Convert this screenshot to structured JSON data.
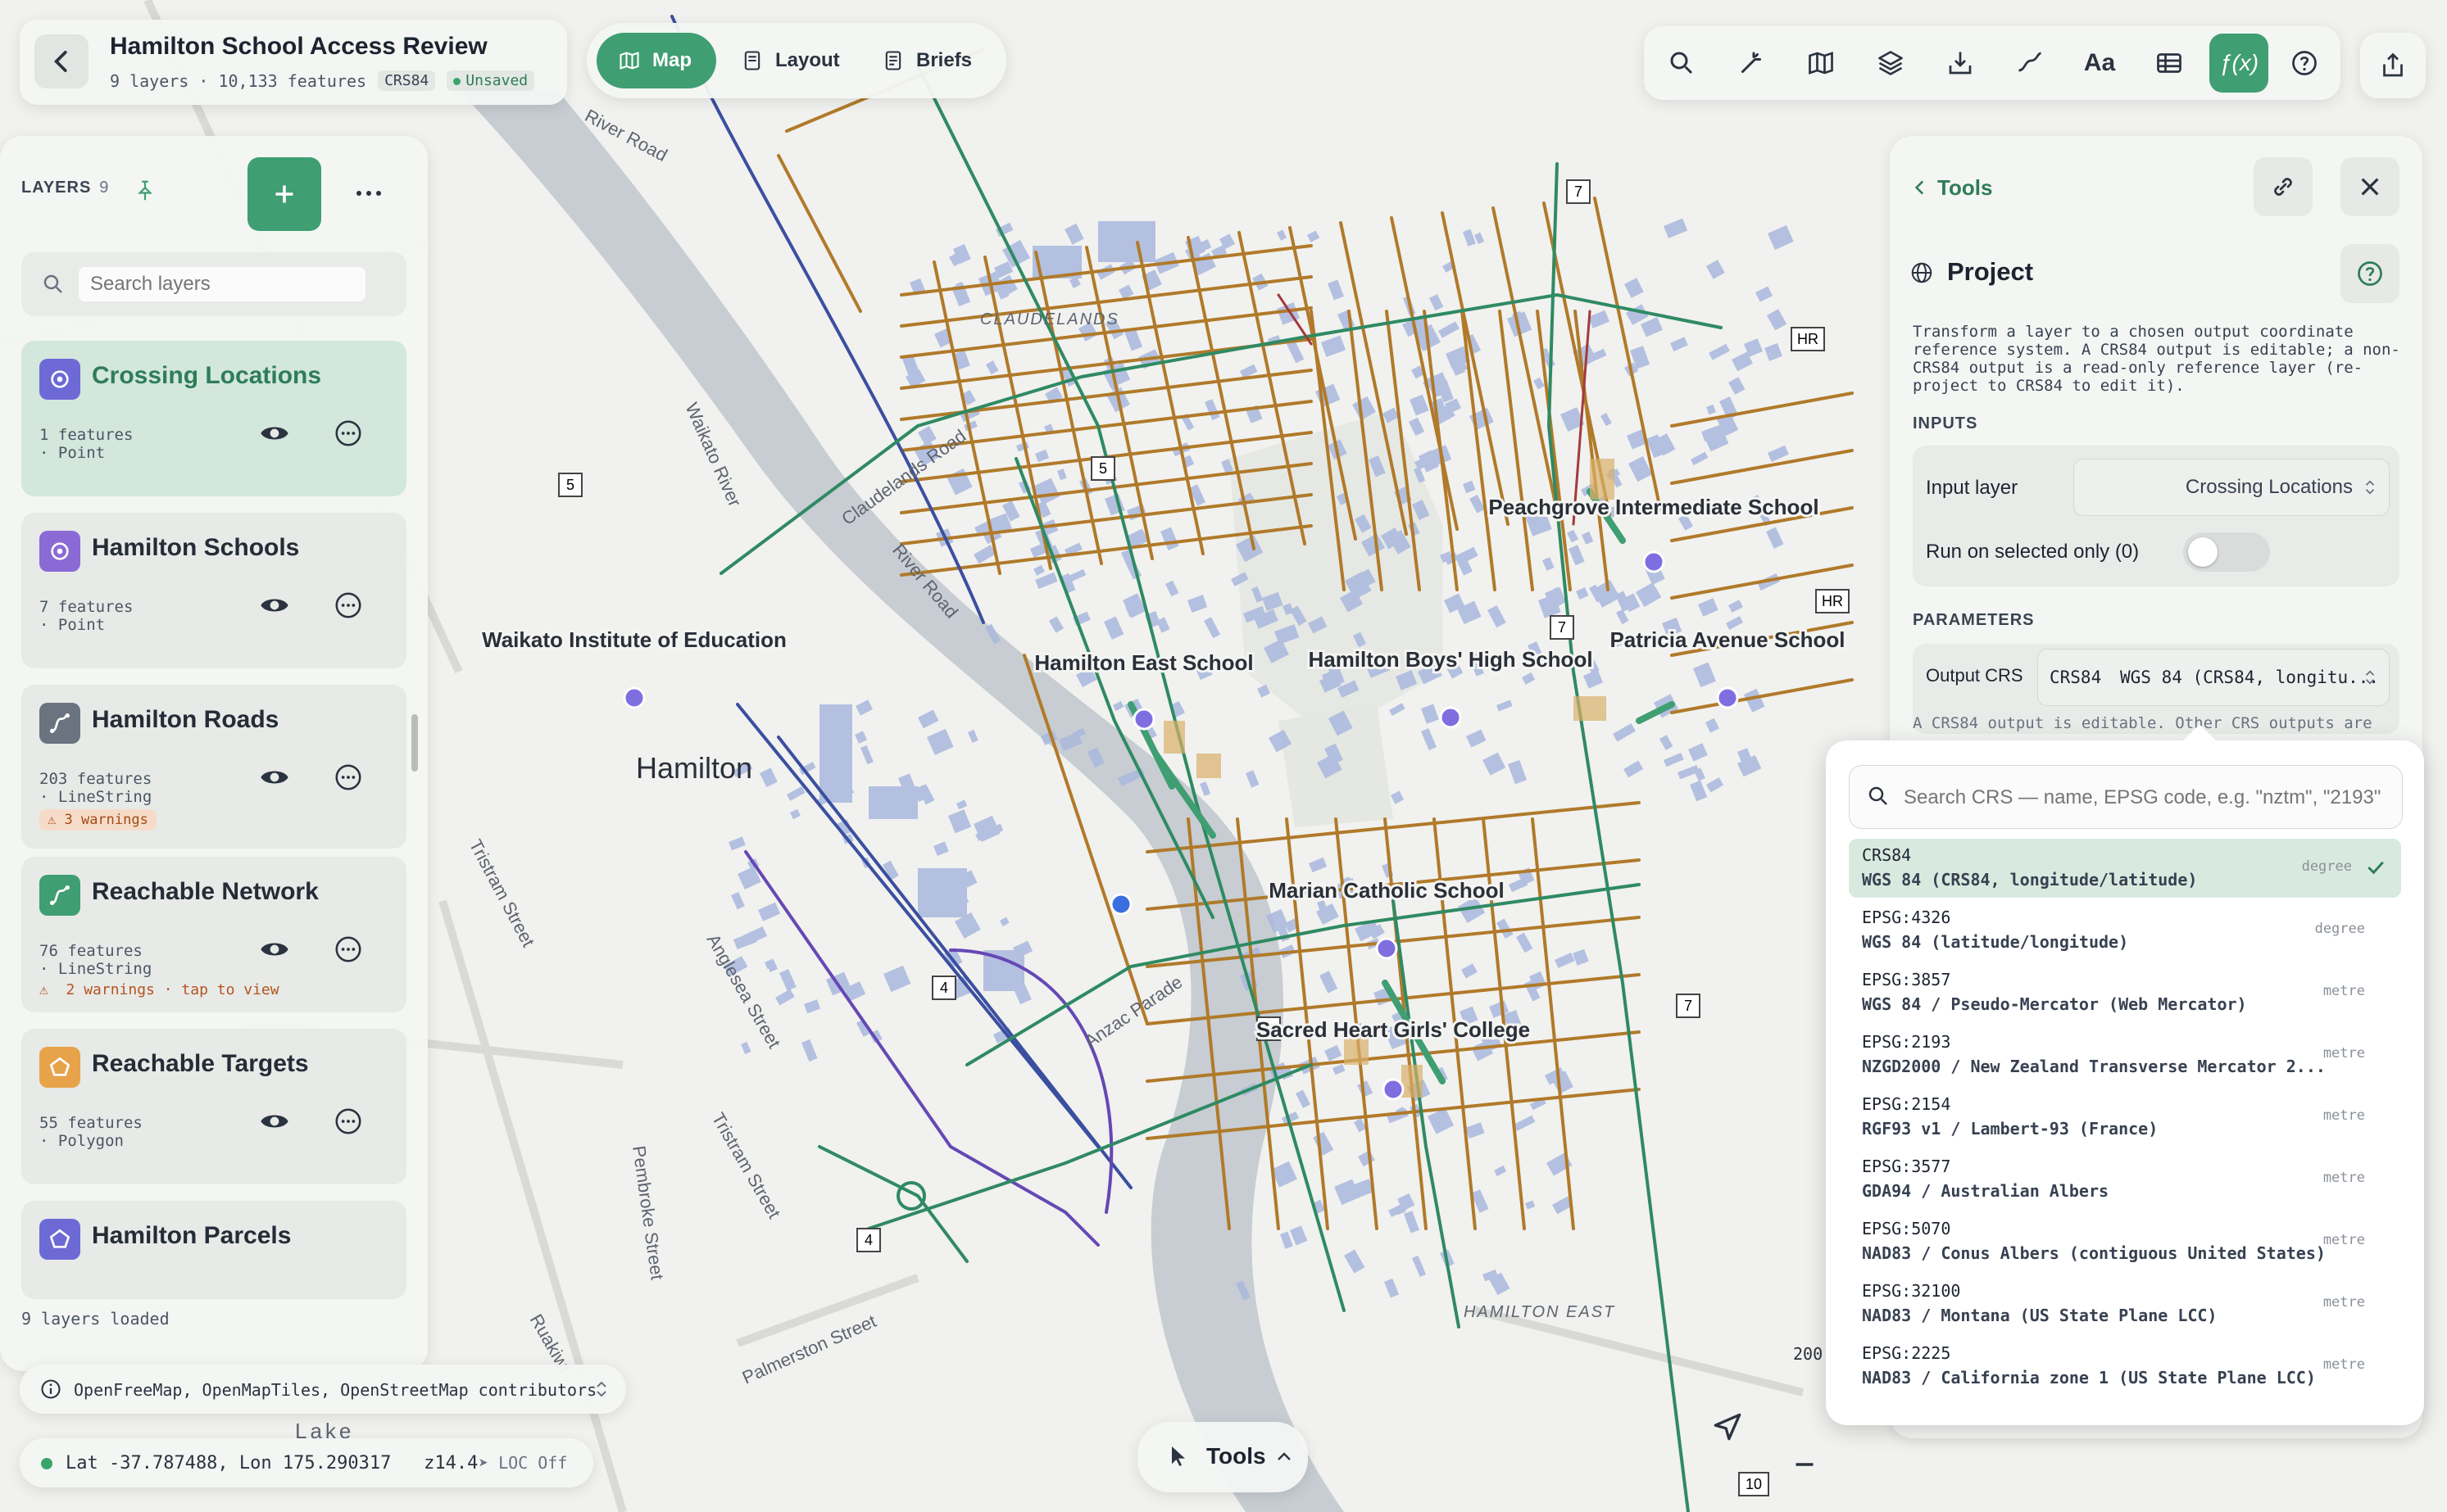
{
  "header": {
    "title": "Hamilton School Access Review",
    "subtitle": "9 layers · 10,133 features",
    "crs_chip": "CRS84",
    "save_status": "Unsaved"
  },
  "modes": [
    {
      "label": "Map",
      "icon": "map-icon",
      "active": true
    },
    {
      "label": "Layout",
      "icon": "layout-icon",
      "active": false
    },
    {
      "label": "Briefs",
      "icon": "briefs-icon",
      "active": false
    }
  ],
  "toolbar": [
    "search-icon",
    "magic-wand-icon",
    "map-icon",
    "layers-stack-icon",
    "import-icon",
    "draw-line-icon",
    "text-icon",
    "table-icon",
    "function-icon",
    "help-icon"
  ],
  "toolbar_active": "function-icon",
  "toolbar_text_label": "Aa",
  "toolbar_function_label": "ƒ(x)",
  "layers_panel": {
    "title": "LAYERS",
    "count": "9",
    "search_placeholder": "Search layers",
    "footer": "9 layers loaded",
    "items": [
      {
        "name": "Crossing Locations",
        "meta": "1 features\n· Point",
        "icon": "point-layer-icon",
        "color": "#6d6ad6",
        "selected": true
      },
      {
        "name": "Hamilton Schools",
        "meta": "7 features\n· Point",
        "icon": "point-layer-icon",
        "color": "#8b6ad6",
        "selected": false
      },
      {
        "name": "Hamilton Roads",
        "meta": "203 features\n· LineString",
        "icon": "line-layer-icon",
        "color": "#6b7280",
        "warning_chip": "3 warnings",
        "selected": false
      },
      {
        "name": "Reachable Network",
        "meta": "76 features\n· LineString",
        "icon": "line-layer-icon",
        "color": "#3f9e72",
        "warning_line": "2 warnings · tap to view",
        "selected": false
      },
      {
        "name": "Reachable Targets",
        "meta": "55 features\n· Polygon",
        "icon": "polygon-layer-icon",
        "color": "#e7a34a",
        "selected": false
      },
      {
        "name": "Hamilton Parcels",
        "meta": "",
        "icon": "polygon-layer-icon",
        "color": "#6d6ad6",
        "selected": false
      }
    ]
  },
  "attribution": "OpenFreeMap, OpenMapTiles, OpenStreetMap contributors",
  "status": {
    "coords": "Lat -37.787488, Lon 175.290317",
    "zoom": "z14.4",
    "loc": "LOC Off"
  },
  "bottom_tools": {
    "label": "Tools"
  },
  "tools_panel": {
    "header": "Tools",
    "tool_name": "Project",
    "description": "Transform a layer to a chosen output coordinate reference system. A CRS84 output is editable; a non-CRS84 output is a read-only reference layer (re-project to CRS84 to edit it).",
    "inputs_label": "INPUTS",
    "input_layer_label": "Input layer",
    "input_layer_value": "Crossing Locations",
    "run_selected_label": "Run on selected only (0)",
    "parameters_label": "PARAMETERS",
    "output_crs_label": "Output CRS",
    "output_crs_code": "CRS84",
    "output_crs_value": "WGS 84 (CRS84, longitu...",
    "hint": "A CRS84 output is editable. Other CRS outputs are"
  },
  "crs_dropdown": {
    "placeholder": "Search CRS — name, EPSG code, e.g. \"nztm\", \"2193\"",
    "options": [
      {
        "code": "CRS84",
        "name": "WGS 84 (CRS84, longitude/latitude)",
        "unit": "degree",
        "selected": true
      },
      {
        "code": "EPSG:4326",
        "name": "WGS 84 (latitude/longitude)",
        "unit": "degree",
        "selected": false
      },
      {
        "code": "EPSG:3857",
        "name": "WGS 84 / Pseudo-Mercator (Web Mercator)",
        "unit": "metre",
        "selected": false
      },
      {
        "code": "EPSG:2193",
        "name": "NZGD2000 / New Zealand Transverse Mercator 2...",
        "unit": "metre",
        "selected": false
      },
      {
        "code": "EPSG:2154",
        "name": "RGF93 v1 / Lambert-93 (France)",
        "unit": "metre",
        "selected": false
      },
      {
        "code": "EPSG:3577",
        "name": "GDA94 / Australian Albers",
        "unit": "metre",
        "selected": false
      },
      {
        "code": "EPSG:5070",
        "name": "NAD83 / Conus Albers (contiguous United States)",
        "unit": "metre",
        "selected": false
      },
      {
        "code": "EPSG:32100",
        "name": "NAD83 / Montana (US State Plane LCC)",
        "unit": "metre",
        "selected": false
      },
      {
        "code": "EPSG:2225",
        "name": "NAD83 / California zone 1 (US State Plane LCC)",
        "unit": "metre",
        "selected": false
      }
    ]
  },
  "map": {
    "place_labels": [
      {
        "text": "Hamilton",
        "kind": "city"
      },
      {
        "text": "CLAUDELANDS",
        "kind": "suburb"
      },
      {
        "text": "HAMILTON EAST",
        "kind": "suburb"
      },
      {
        "text": "Waikato River",
        "kind": "water"
      },
      {
        "text": "Lake",
        "kind": "water"
      }
    ],
    "street_labels": [
      "River Road",
      "Claudelands Road",
      "River Road",
      "Anglesea Street",
      "Tristram Street",
      "Pembroke Street",
      "Palmerston Street",
      "Anzac Parade",
      "Ruakiwi",
      "Tristram Street"
    ],
    "schools": [
      "Waikato Institute of Education",
      "Hamilton East School",
      "Hamilton Boys' High School",
      "Peachgrove Intermediate School",
      "Patricia Avenue School",
      "Marian Catholic School",
      "Sacred Heart Girls' College"
    ],
    "route_shields": [
      "5",
      "5",
      "7",
      "7",
      "7",
      "HR",
      "HR",
      "4",
      "4",
      "6",
      "10"
    ],
    "scale_label": "200.0",
    "colors": {
      "river": "#c6ccd1",
      "road_green": "#2f8a63",
      "road_blue": "#3b4fa0",
      "road_purple": "#6548b5",
      "road_orange": "#b07a2a",
      "buildings": "#a9b8dd",
      "school_point": "#7f6ee0"
    }
  }
}
